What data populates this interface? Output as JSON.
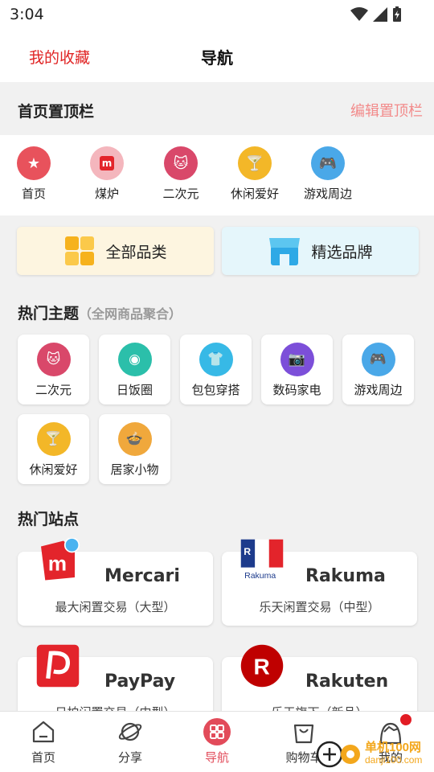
{
  "status": {
    "time": "3:04"
  },
  "nav": {
    "favorites": "我的收藏",
    "title": "导航"
  },
  "pinned": {
    "label": "首页置顶栏",
    "edit": "编辑置顶栏",
    "items": [
      {
        "label": "首页",
        "icon": "star-icon",
        "color": "#e8525c"
      },
      {
        "label": "煤炉",
        "icon": "mercari-icon",
        "color": "#f4b6bd"
      },
      {
        "label": "二次元",
        "icon": "cat-icon",
        "color": "#d9486a"
      },
      {
        "label": "休闲爱好",
        "icon": "cocktail-icon",
        "color": "#f3b728"
      },
      {
        "label": "游戏周边",
        "icon": "gamepad-icon",
        "color": "#4aa8e8"
      }
    ]
  },
  "categories": {
    "all": "全部品类",
    "brands": "精选品牌"
  },
  "themes": {
    "title": "热门主题",
    "subtitle": "（全网商品聚合）",
    "items": [
      {
        "label": "二次元",
        "icon": "cat-icon",
        "color": "#d9486a"
      },
      {
        "label": "日饭圈",
        "icon": "ring-icon",
        "color": "#2bbfaa"
      },
      {
        "label": "包包穿搭",
        "icon": "shirt-icon",
        "color": "#37b9e6"
      },
      {
        "label": "数码家电",
        "icon": "camera-icon",
        "color": "#7c4fd9"
      },
      {
        "label": "游戏周边",
        "icon": "gamepad-icon",
        "color": "#4aa8e8"
      },
      {
        "label": "休闲爱好",
        "icon": "cocktail-icon",
        "color": "#f3b728"
      },
      {
        "label": "居家小物",
        "icon": "pot-icon",
        "color": "#f0a83c"
      }
    ]
  },
  "sites": {
    "title": "热门站点",
    "items": [
      {
        "name": "Mercari",
        "desc": "最大闲置交易（大型）",
        "icon": "mercari-logo"
      },
      {
        "name": "Rakuma",
        "desc": "乐天闲置交易（中型）",
        "icon": "rakuma-logo",
        "logo_text": "Rakuma",
        "logo_letter": "R"
      },
      {
        "name": "PayPay",
        "desc": "日拍闲置交易（中型）",
        "icon": "paypay-logo"
      },
      {
        "name": "Rakuten",
        "desc": "乐天旗下（新品）",
        "icon": "rakuten-logo",
        "logo_letter": "R"
      }
    ]
  },
  "tabs": [
    {
      "label": "首页",
      "icon": "home-icon"
    },
    {
      "label": "分享",
      "icon": "planet-icon"
    },
    {
      "label": "导航",
      "icon": "grid-icon",
      "active": true
    },
    {
      "label": "购物车",
      "icon": "bag-icon"
    },
    {
      "label": "我的",
      "icon": "profile-icon"
    }
  ],
  "watermark": {
    "text": "单机100网",
    "url": "danji100.com"
  },
  "colors": {
    "accent": "#e24b5a",
    "favorites": "#e02424",
    "edit": "#f28a8a"
  }
}
